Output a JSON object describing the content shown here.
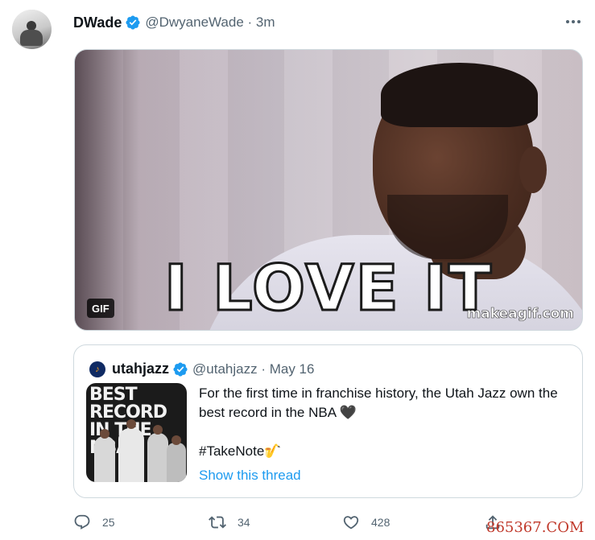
{
  "author": {
    "display_name": "DWade",
    "handle_time": "@DwyaneWade · 3m"
  },
  "media": {
    "caption": "I LOVE IT",
    "watermark": "makeagif.com",
    "badge": "GIF"
  },
  "quoted": {
    "display_name": "utahjazz",
    "handle_time": "@utahjazz · May 16",
    "thumb_text": "BEST RECORD IN THE NBA",
    "text": "For the first time in franchise history, the Utah Jazz own the best record in the NBA 🖤",
    "hashtag": "#TakeNote🎷",
    "show_thread": "Show this thread"
  },
  "actions": {
    "reply_count": "25",
    "retweet_count": "34",
    "like_count": "428"
  },
  "site_watermark": "865367.COM",
  "colors": {
    "link": "#1d9bf0",
    "muted": "#536471",
    "verified": "#1d9bf0"
  }
}
